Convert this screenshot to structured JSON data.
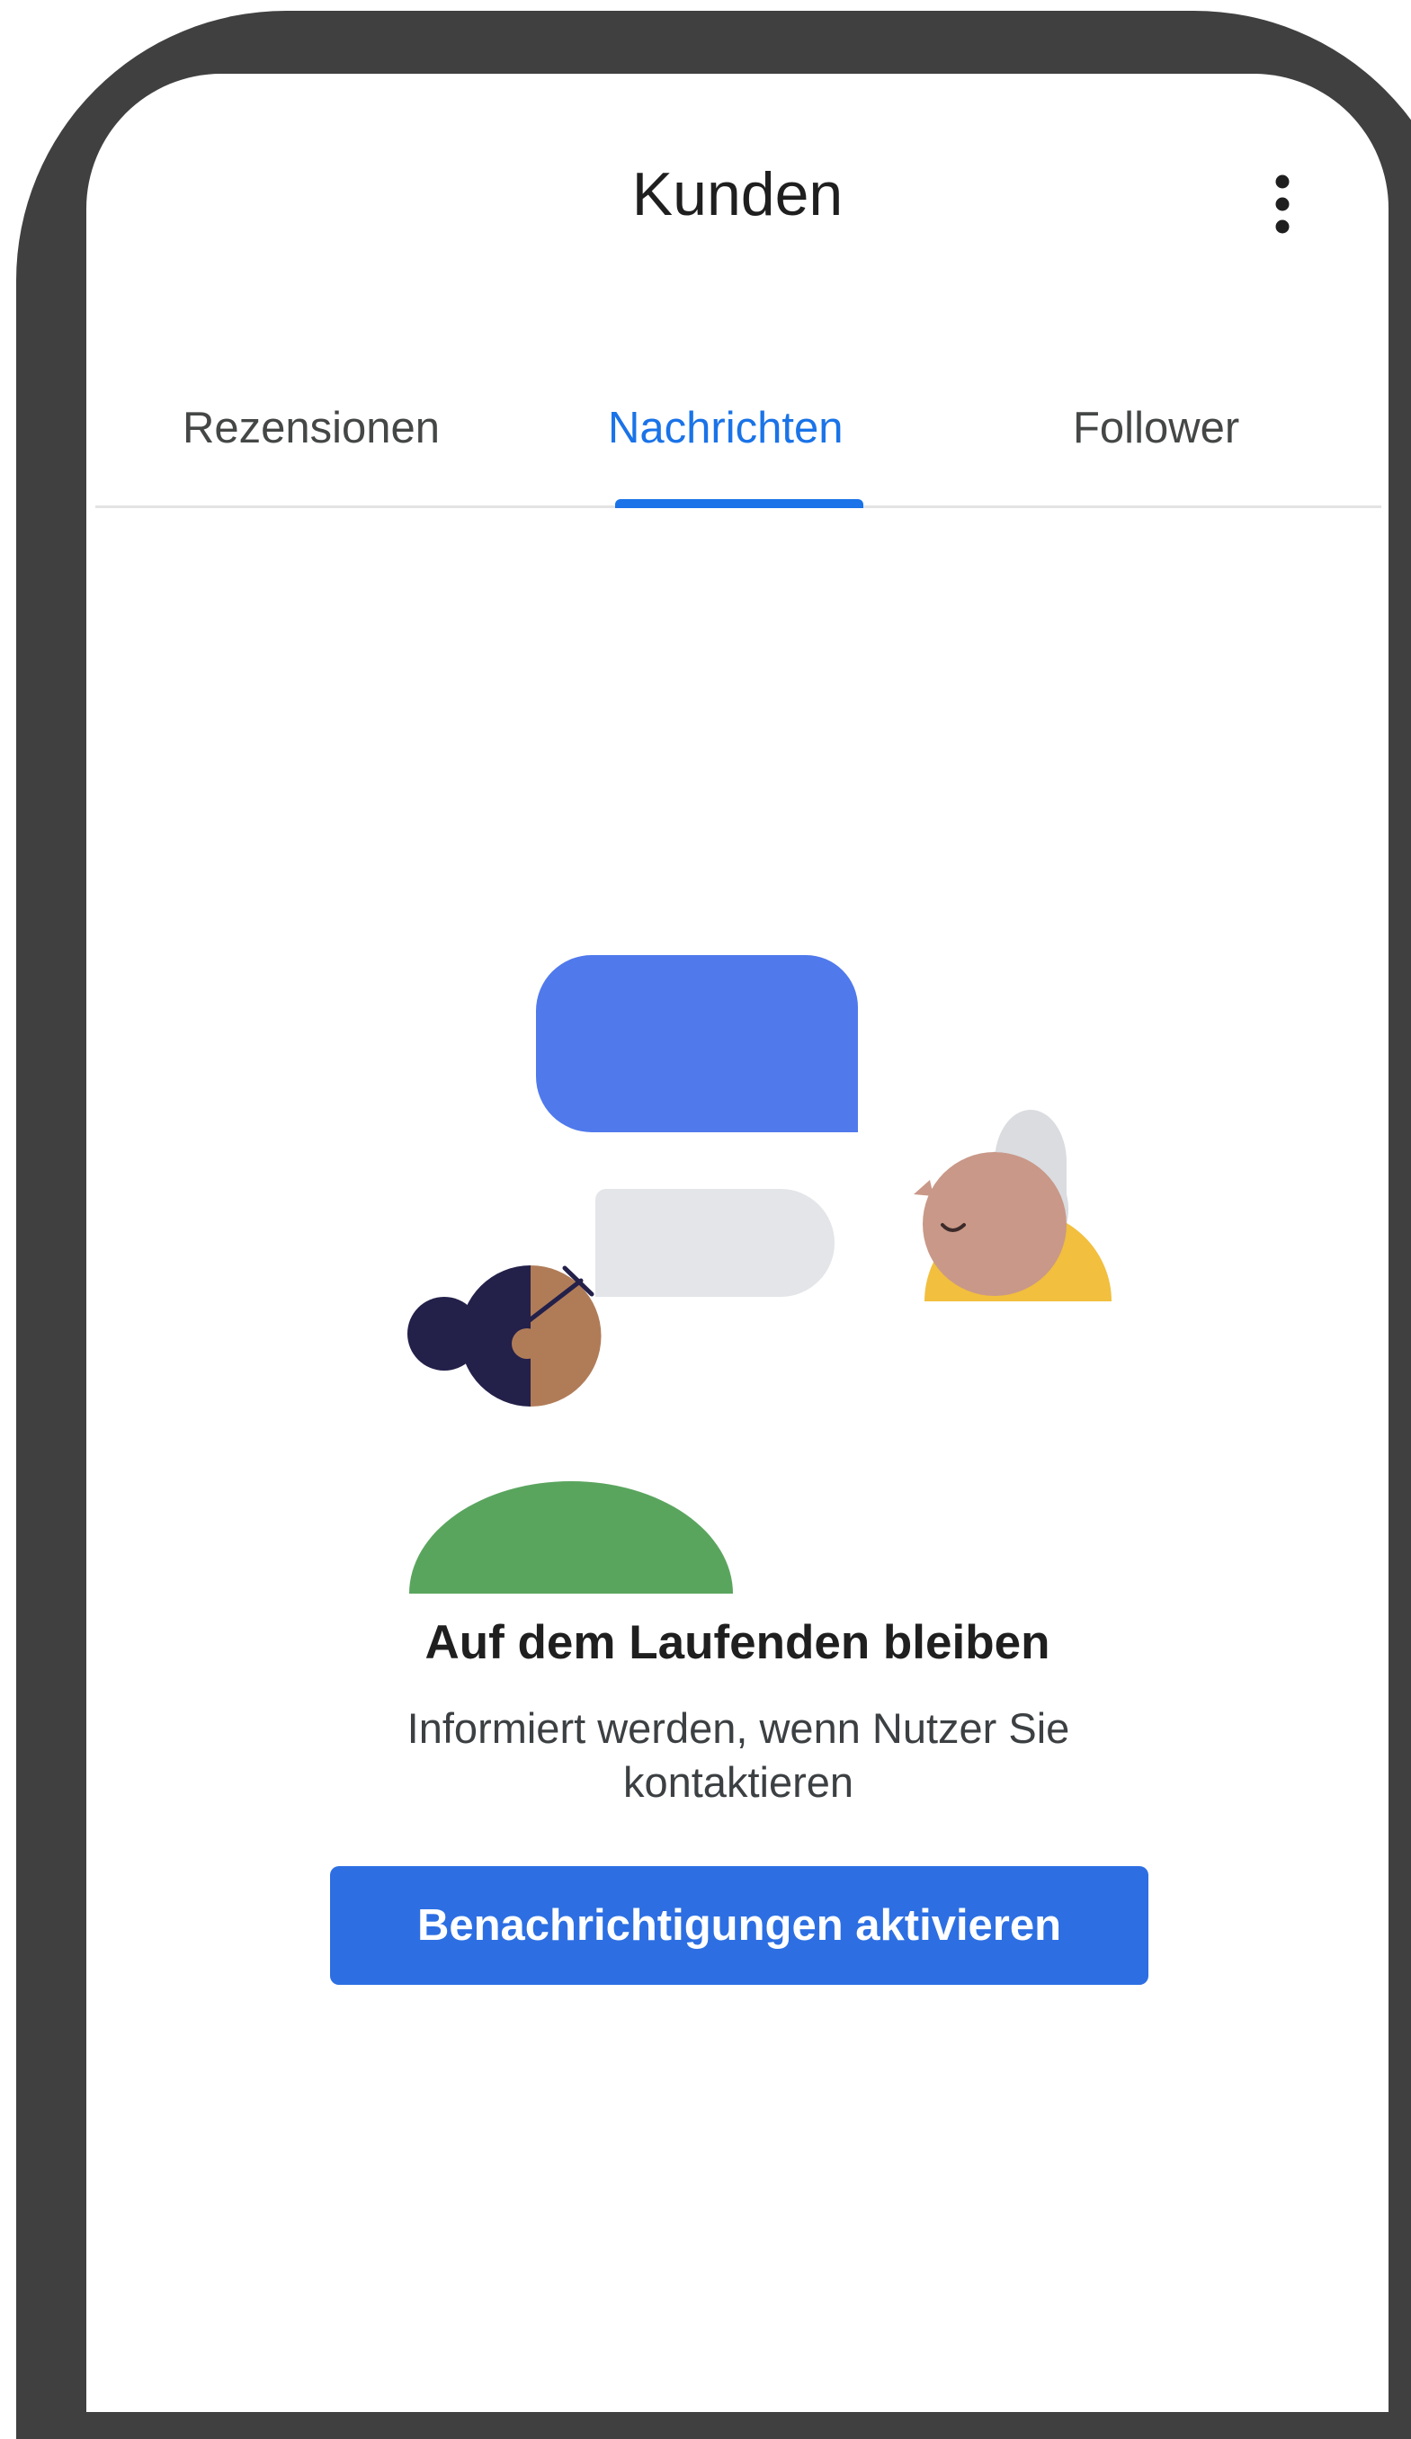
{
  "header": {
    "title": "Kunden",
    "more_icon": "more-vert-icon"
  },
  "tabs": [
    {
      "label": "Rezensionen",
      "active": false
    },
    {
      "label": "Nachrichten",
      "active": true
    },
    {
      "label": "Follower",
      "active": false
    }
  ],
  "empty_state": {
    "title": "Auf dem Laufenden bleiben",
    "description": "Informiert werden, wenn Nutzer Sie kontaktieren",
    "button_label": "Benachrichtigungen aktivieren"
  },
  "colors": {
    "accent": "#1a73e8",
    "button": "#2d6fe2",
    "frame": "#404040",
    "bubble_blue": "#5079ec",
    "bubble_grey": "#e3e5e8",
    "person_green": "#5aa55e",
    "person_yellow": "#f2bf3e"
  }
}
